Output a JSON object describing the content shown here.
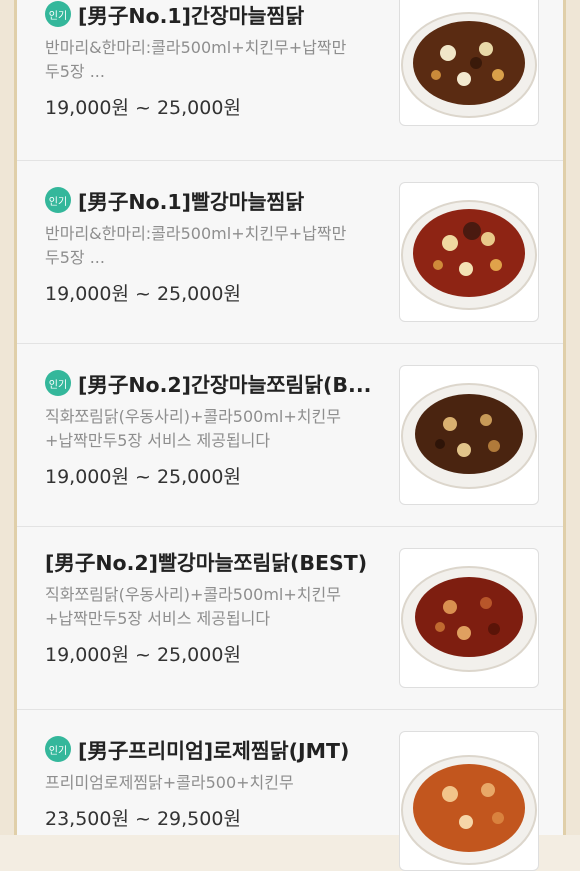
{
  "badge_label": "인기",
  "colors": {
    "badge": "#34b79b",
    "frame": "#e0cfa9",
    "soy_dish": "#5a2b12",
    "red_dish": "#8e2414",
    "rose_dish": "#c2561e"
  },
  "items": [
    {
      "title": "[男子No.1]간장마늘찜닭",
      "desc_line1": "반마리&한마리:콜라500ml+치킨무+납짝만",
      "desc_line2": "두5장 ...",
      "price": "19,000원 ~ 25,000원",
      "popular": true,
      "image": "soy-braised-chicken-dish"
    },
    {
      "title": "[男子No.1]빨강마늘찜닭",
      "desc_line1": "반마리&한마리:콜라500ml+치킨무+납짝만",
      "desc_line2": "두5장 ...",
      "price": "19,000원 ~ 25,000원",
      "popular": true,
      "image": "red-braised-chicken-dish"
    },
    {
      "title": "[男子No.2]간장마늘쪼림닭(B...",
      "desc_line1": "직화쪼림닭(우동사리)+콜라500ml+치킨무",
      "desc_line2": "+납짝만두5장 서비스 제공됩니다",
      "price": "19,000원 ~ 25,000원",
      "popular": true,
      "image": "soy-glazed-chicken-dish"
    },
    {
      "title": "[男子No.2]빨강마늘쪼림닭(BEST)",
      "desc_line1": "직화쪼림닭(우동사리)+콜라500ml+치킨무",
      "desc_line2": "+납짝만두5장 서비스 제공됩니다",
      "price": "19,000원 ~ 25,000원",
      "popular": false,
      "image": "red-glazed-chicken-dish"
    },
    {
      "title": "[男子프리미엄]로제찜닭(JMT)",
      "desc_line1": "프리미엄로제찜닭+콜라500+치킨무",
      "desc_line2": "",
      "price": "23,500원 ~ 29,500원",
      "popular": true,
      "image": "rose-braised-chicken-dish"
    }
  ]
}
